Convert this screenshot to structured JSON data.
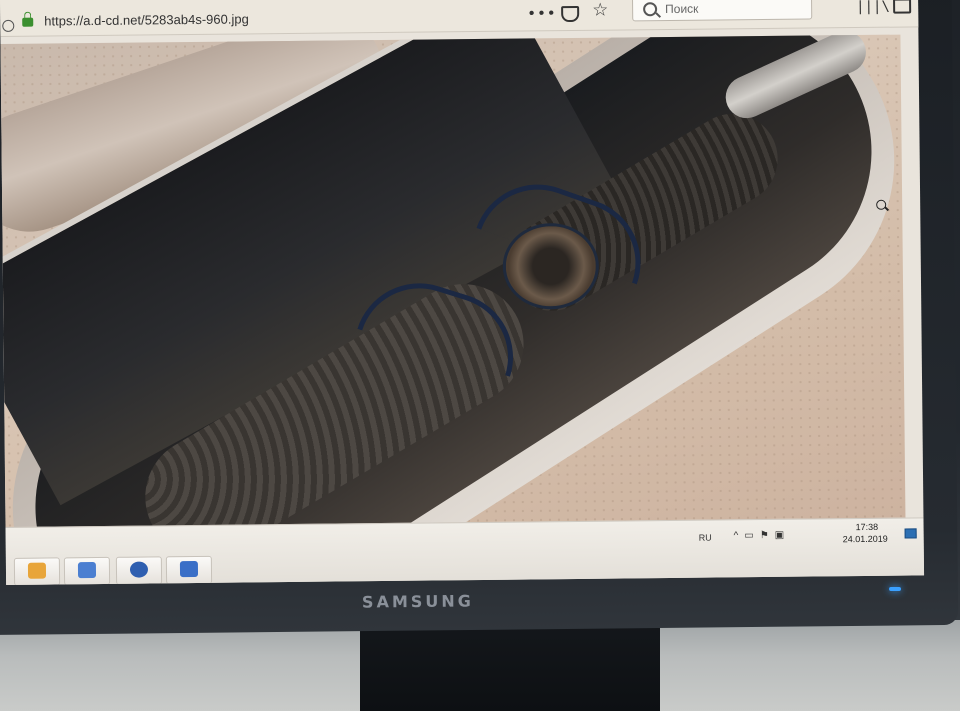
{
  "browser": {
    "address": "https://a.d-cd.net/5283ab4s-960.jpg",
    "page_actions": "•••",
    "search_placeholder": "Поиск"
  },
  "taskbar": {
    "pinned": [
      {
        "icon": "folder-icon",
        "color": "#e8a53a"
      },
      {
        "icon": "graphics-app-icon",
        "color": "#4b7fd1"
      },
      {
        "icon": "mail-app-icon",
        "color": "#2f5fb0"
      },
      {
        "icon": "pdf-document-icon",
        "color": "#3a6fc7"
      }
    ],
    "tray": {
      "language": "RU",
      "icons": [
        "chevron-up-icon",
        "network-icon",
        "flag-icon",
        "display-icon"
      ],
      "time": "17:38",
      "date": "24.01.2019"
    }
  },
  "monitor": {
    "brand": "SAMSUNG",
    "power_led_color": "#3aa0ff"
  }
}
